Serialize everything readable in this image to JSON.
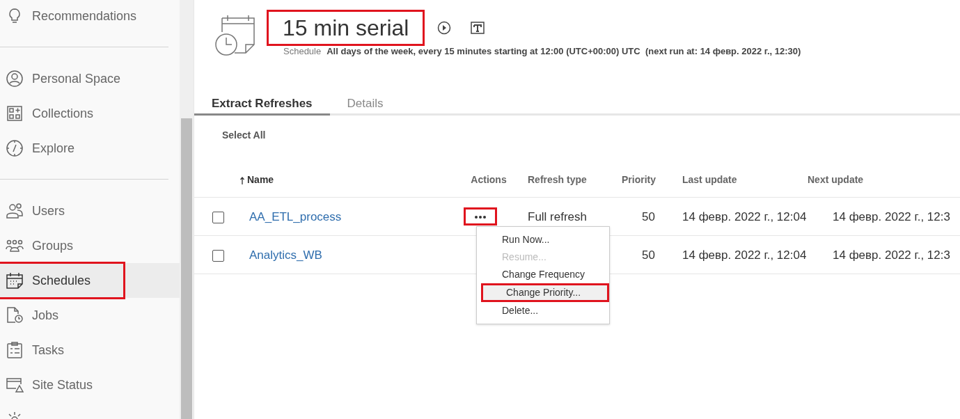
{
  "sidebar": {
    "sections": [
      {
        "items": [
          {
            "kind": "recommendations",
            "label": "Recommendations",
            "selected": false,
            "highlighted": false
          }
        ]
      },
      {
        "items": [
          {
            "kind": "person",
            "label": "Personal Space",
            "selected": false,
            "highlighted": false
          },
          {
            "kind": "collections",
            "label": "Collections",
            "selected": false,
            "highlighted": false
          },
          {
            "kind": "explore",
            "label": "Explore",
            "selected": false,
            "highlighted": false
          }
        ]
      },
      {
        "items": [
          {
            "kind": "users",
            "label": "Users",
            "selected": false,
            "highlighted": false
          },
          {
            "kind": "groups",
            "label": "Groups",
            "selected": false,
            "highlighted": false
          },
          {
            "kind": "schedules",
            "label": "Schedules",
            "selected": true,
            "highlighted": true
          },
          {
            "kind": "jobs",
            "label": "Jobs",
            "selected": false,
            "highlighted": false
          },
          {
            "kind": "tasks",
            "label": "Tasks",
            "selected": false,
            "highlighted": false
          },
          {
            "kind": "site_status",
            "label": "Site Status",
            "selected": false,
            "highlighted": false
          },
          {
            "kind": "settings",
            "selected": false,
            "highlighted": false
          }
        ]
      }
    ]
  },
  "header": {
    "title": "15 min serial",
    "title_highlighted": true,
    "schedule_label": "Schedule",
    "schedule_text": "All days of the week, every 15 minutes starting at 12:00 (UTC+00:00) UTC  (next run at: 14 февр. 2022 г., 12:30)"
  },
  "tabs": [
    {
      "label": "Extract Refreshes",
      "selected": true
    },
    {
      "label": "Details",
      "selected": false
    }
  ],
  "select_all": "Select All",
  "table": {
    "columns": [
      {
        "label": "Name",
        "sorted": true
      },
      {
        "label": "Actions",
        "sorted": false
      },
      {
        "label": "Refresh type",
        "sorted": false
      },
      {
        "label": "Priority",
        "sorted": false
      },
      {
        "label": "Last update",
        "sorted": false
      },
      {
        "label": "Next update",
        "sorted": false
      }
    ],
    "rows": [
      {
        "checked": false,
        "name": "AA_ETL_process",
        "menu_open": true,
        "actions_highlighted": true,
        "refresh_type": "Full refresh",
        "priority": "50",
        "last_update": "14 февр. 2022 г., 12:04",
        "next_update": "14 февр. 2022 г., 12:3"
      },
      {
        "checked": false,
        "name": "Analytics_WB",
        "menu_open": false,
        "actions_highlighted": false,
        "priority": "50",
        "last_update": "14 февр. 2022 г., 12:04",
        "next_update": "14 февр. 2022 г., 12:3"
      }
    ]
  },
  "menu": {
    "items": [
      {
        "label": "Run Now...",
        "disabled": false,
        "hovered": false,
        "highlighted": false
      },
      {
        "label": "Resume...",
        "disabled": true,
        "hovered": false,
        "highlighted": false
      },
      {
        "label": "Change Frequency",
        "disabled": false,
        "hovered": false,
        "highlighted": false
      },
      {
        "label": "Change Priority...",
        "disabled": false,
        "hovered": true,
        "highlighted": true
      },
      {
        "label": "Delete...",
        "disabled": false,
        "hovered": false,
        "highlighted": false
      }
    ]
  }
}
